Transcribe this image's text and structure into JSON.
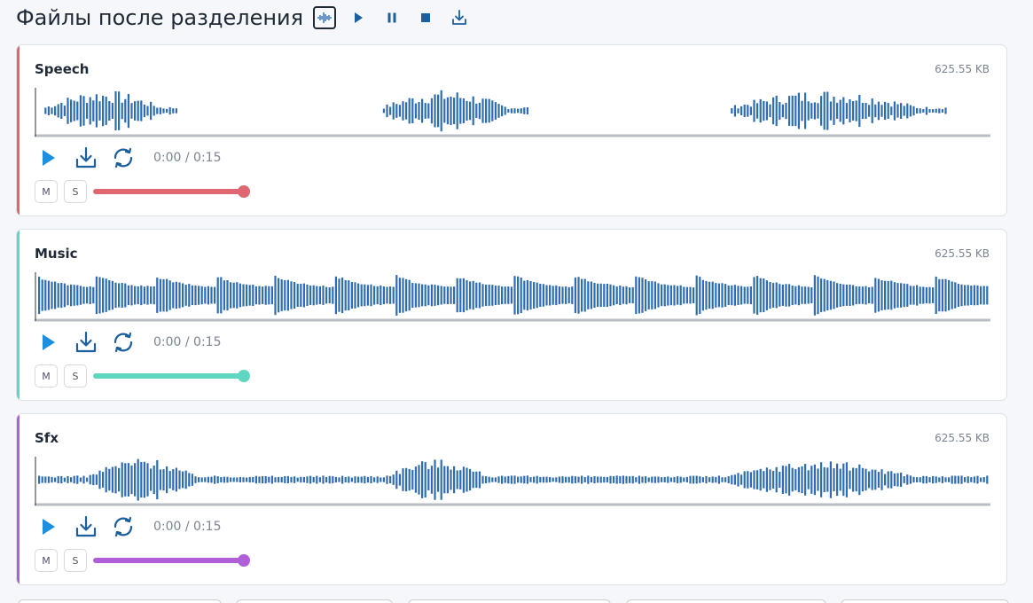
{
  "header": {
    "title": "Файлы после разделения",
    "buttons": [
      {
        "icon": "waveform-icon"
      },
      {
        "icon": "play-icon"
      },
      {
        "icon": "pause-icon"
      },
      {
        "icon": "stop-icon"
      },
      {
        "icon": "download-icon"
      }
    ]
  },
  "colors": {
    "waveform": "#2e6db4",
    "control_blue": "#1c8fe0",
    "icon_dark_blue": "#1c5f9e"
  },
  "tracks": [
    {
      "name": "Speech",
      "size": "625.55 KB",
      "time": "0:00 / 0:15",
      "mute_label": "M",
      "solo_label": "S",
      "volume": 1.0,
      "accent": "#e06672"
    },
    {
      "name": "Music",
      "size": "625.55 KB",
      "time": "0:00 / 0:15",
      "mute_label": "M",
      "solo_label": "S",
      "volume": 1.0,
      "accent": "#5fd6c0"
    },
    {
      "name": "Sfx",
      "size": "625.55 KB",
      "time": "0:00 / 0:15",
      "mute_label": "M",
      "solo_label": "S",
      "volume": 1.0,
      "accent": "#b05fd6"
    }
  ]
}
